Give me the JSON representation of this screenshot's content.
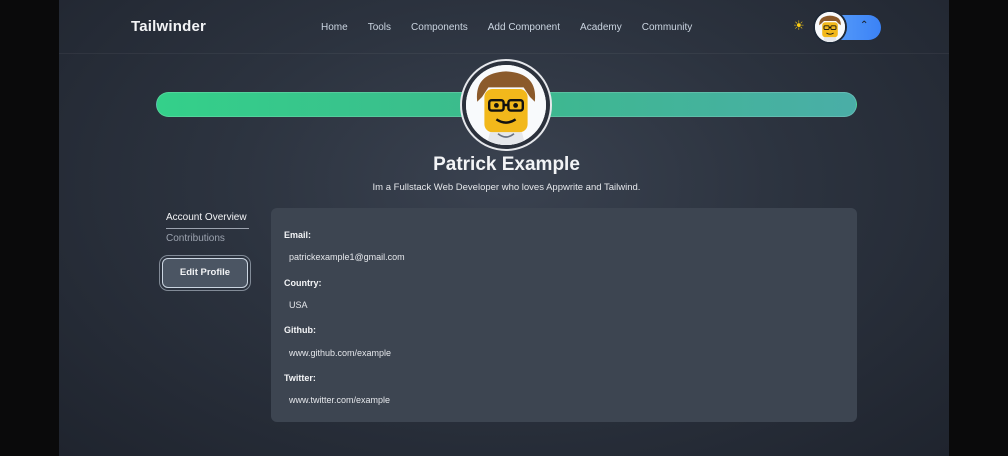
{
  "navbar": {
    "brand": "Tailwinder",
    "links": [
      "Home",
      "Tools",
      "Components",
      "Add Component",
      "Academy",
      "Community"
    ],
    "theme_icon": "sun-icon",
    "menu_icon": "chevron-up-icon"
  },
  "profile": {
    "name": "Patrick Example",
    "bio": "Im a Fullstack Web Developer who loves Appwrite and Tailwind."
  },
  "sidebar": {
    "tabs": [
      "Account Overview",
      "Contributions"
    ],
    "edit_button": "Edit Profile"
  },
  "details": {
    "email_label": "Email:",
    "email_value": "patrickexample1@gmail.com",
    "country_label": "Country:",
    "country_value": "USA",
    "github_label": "Github:",
    "github_value": "www.github.com/example",
    "twitter_label": "Twitter:",
    "twitter_value": "www.twitter.com/example"
  },
  "colors": {
    "banner_start": "#34d08a",
    "banner_end": "#4aaea7",
    "accent": "#3b82f6",
    "sun": "#facc15"
  }
}
